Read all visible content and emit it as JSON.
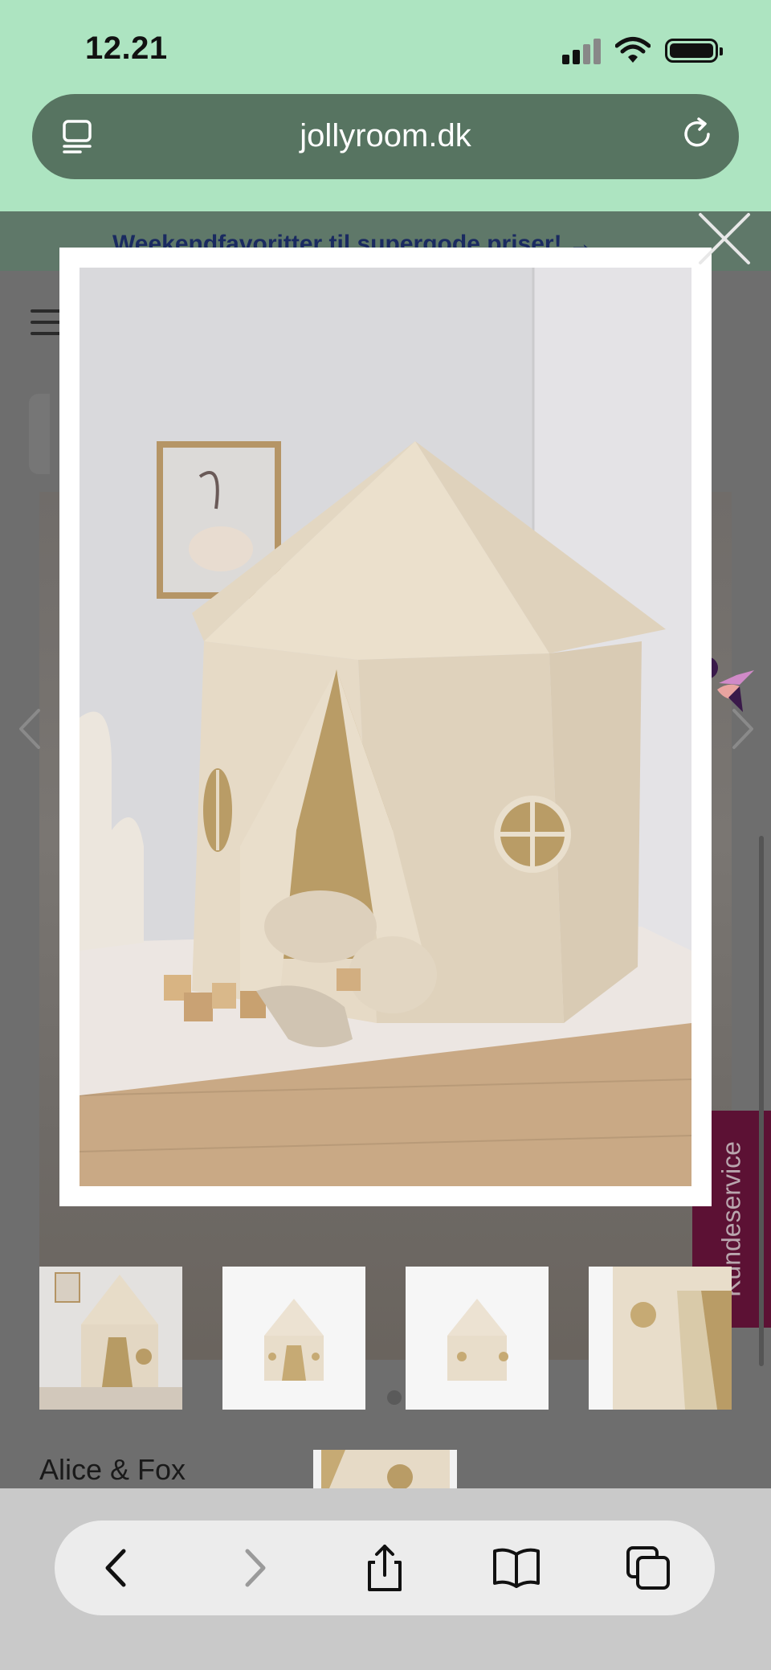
{
  "status_bar": {
    "time": "12.21"
  },
  "browser": {
    "url": "jollyroom.dk"
  },
  "page": {
    "promo_text": "Weekendfavoritter til supergode priser! →",
    "brand": "Alice & Fox",
    "kundeservice_label": "Kundeservice"
  },
  "icons": {
    "tabs": "tabs-icon",
    "reload": "reload-icon",
    "menu": "menu-icon",
    "close": "close-icon",
    "chevron_left": "chevron-left-icon",
    "chevron_right": "chevron-right-icon",
    "back": "back-icon",
    "forward": "forward-icon",
    "share": "share-icon",
    "bookmarks": "bookmarks-icon",
    "tabs_overview": "tabs-overview-icon"
  },
  "colors": {
    "status_bg": "#ade4c1",
    "urlbar_bg": "#577461",
    "overlay": "#6e6e6e",
    "kundeservice_bg": "#5c1134",
    "tent": "#e6dac6"
  }
}
